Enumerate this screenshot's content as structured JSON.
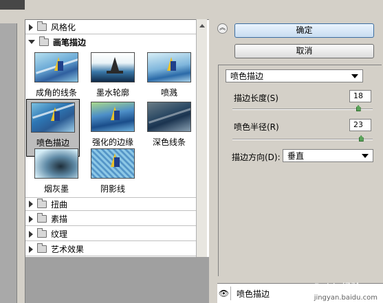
{
  "gallery": {
    "categories_top": [
      {
        "label": "风格化",
        "expanded": false
      }
    ],
    "open_category": {
      "label": "画笔描边",
      "expanded": true
    },
    "filters": [
      {
        "label": "成角的线条"
      },
      {
        "label": "墨水轮廓"
      },
      {
        "label": "喷溅"
      },
      {
        "label": "喷色描边",
        "selected": true
      },
      {
        "label": "强化的边缘"
      },
      {
        "label": "深色线条"
      },
      {
        "label": "烟灰墨"
      },
      {
        "label": "阴影线"
      }
    ],
    "categories_bottom": [
      {
        "label": "扭曲"
      },
      {
        "label": "素描"
      },
      {
        "label": "纹理"
      },
      {
        "label": "艺术效果"
      }
    ]
  },
  "buttons": {
    "ok": "确定",
    "cancel": "取消"
  },
  "settings": {
    "filter_select": "喷色描边",
    "stroke_length": {
      "label": "描边长度(S)",
      "value": "18",
      "level": 0.9
    },
    "spray_radius": {
      "label": "喷色半径(R)",
      "value": "23",
      "level": 0.92
    },
    "stroke_direction": {
      "label": "描边方向(D):",
      "value": "垂直"
    }
  },
  "layers": {
    "items": [
      {
        "label": "喷色描边",
        "visible_icon": "eye-icon"
      }
    ]
  },
  "watermark": {
    "text": "Baidu经验",
    "sub": "jingyan.baidu.com"
  }
}
